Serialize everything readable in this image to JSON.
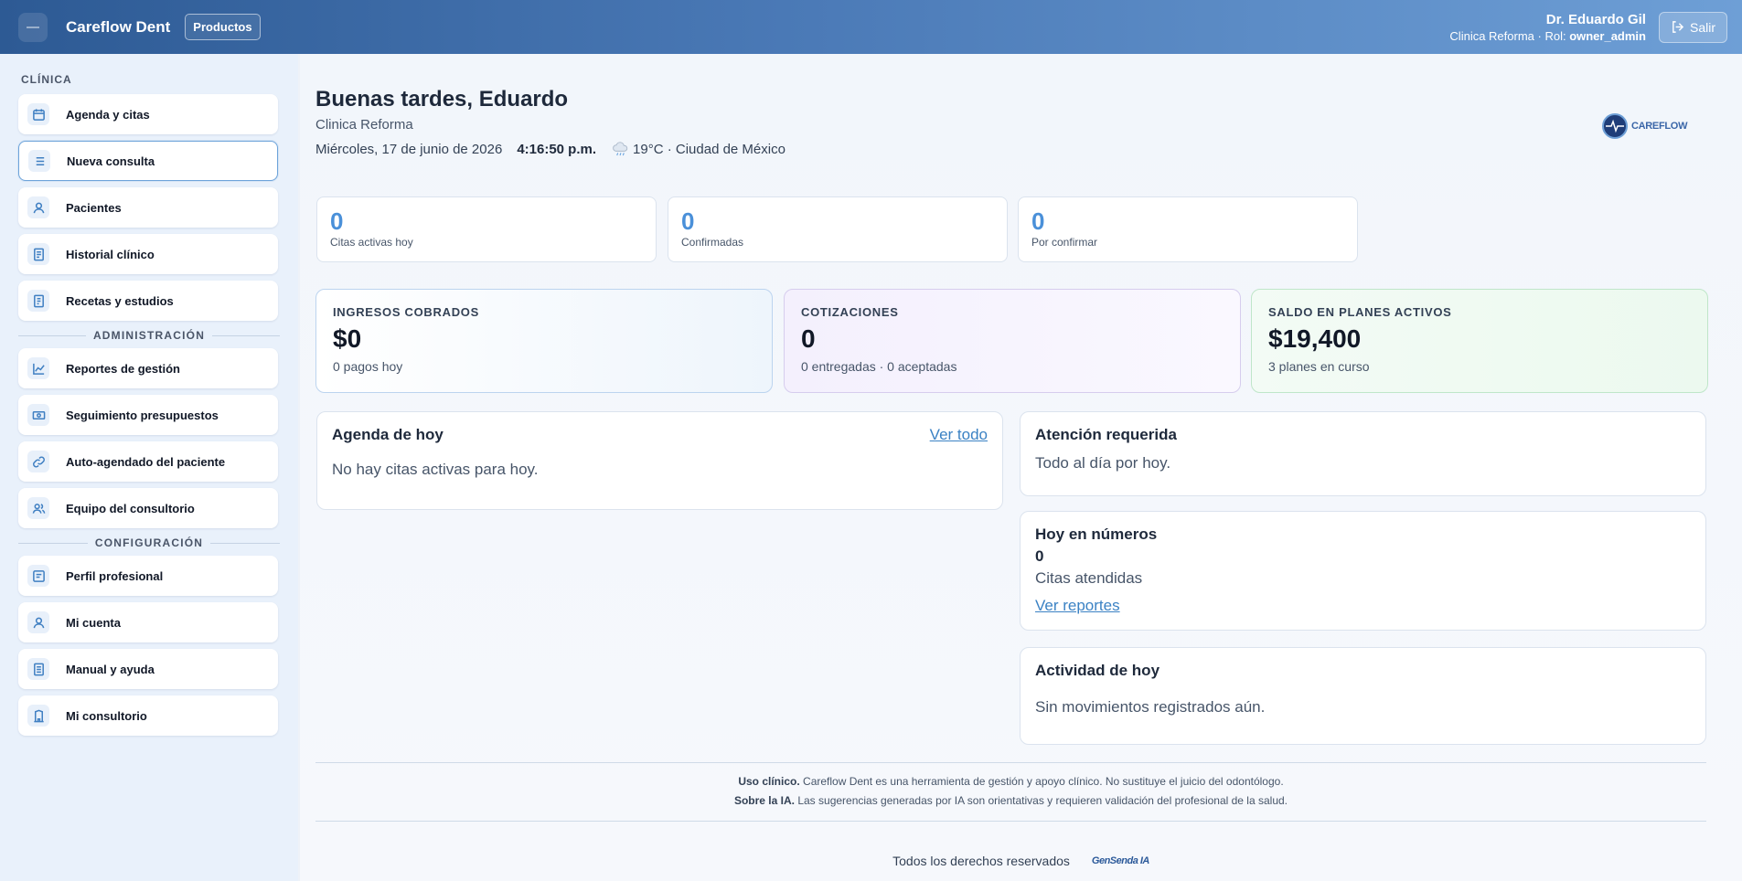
{
  "header": {
    "app_title": "Careflow Dent",
    "products_label": "Productos",
    "user_name": "Dr. Eduardo Gil",
    "clinic_prefix": "Clinica Reforma · Rol: ",
    "role": "owner_admin",
    "logout_label": "Salir"
  },
  "sidebar": {
    "section_clinica": "CLÍNICA",
    "clinica_items": [
      {
        "label": "Agenda y citas",
        "icon": "calendar-icon"
      },
      {
        "label": "Nueva consulta",
        "icon": "list-icon"
      },
      {
        "label": "Pacientes",
        "icon": "user-icon"
      },
      {
        "label": "Historial clínico",
        "icon": "document-icon"
      },
      {
        "label": "Recetas y estudios",
        "icon": "prescription-icon"
      }
    ],
    "section_admin": "ADMINISTRACIÓN",
    "admin_items": [
      {
        "label": "Reportes de gestión",
        "icon": "chart-icon"
      },
      {
        "label": "Seguimiento presupuestos",
        "icon": "money-icon"
      },
      {
        "label": "Auto-agendado del paciente",
        "icon": "link-icon"
      },
      {
        "label": "Equipo del consultorio",
        "icon": "team-icon"
      }
    ],
    "section_config": "CONFIGURACIÓN",
    "config_items": [
      {
        "label": "Perfil profesional",
        "icon": "profile-card-icon"
      },
      {
        "label": "Mi cuenta",
        "icon": "account-icon"
      },
      {
        "label": "Manual y ayuda",
        "icon": "manual-icon"
      },
      {
        "label": "Mi consultorio",
        "icon": "building-icon"
      }
    ]
  },
  "main": {
    "greeting": "Buenas tardes, Eduardo",
    "clinic_name": "Clinica Reforma",
    "date": "Miércoles, 17 de junio de 2026",
    "time": "4:16:50 p.m.",
    "weather": "19°C · Ciudad de México",
    "brand_logo_text": "CAREFLOW"
  },
  "mini_stats": [
    {
      "value": "0",
      "label": "Citas activas hoy"
    },
    {
      "value": "0",
      "label": "Confirmadas"
    },
    {
      "value": "0",
      "label": "Por confirmar"
    }
  ],
  "kpis": {
    "ingresos": {
      "label": "INGRESOS COBRADOS",
      "value": "$0",
      "sub": "0 pagos hoy"
    },
    "cotizaciones": {
      "label": "COTIZACIONES",
      "value": "0",
      "sub": "0 entregadas · 0 aceptadas"
    },
    "saldo": {
      "label": "SALDO EN PLANES ACTIVOS",
      "value": "$19,400",
      "sub": "3 planes en curso"
    }
  },
  "agenda": {
    "title": "Agenda de hoy",
    "link": "Ver todo",
    "empty": "No hay citas activas para hoy."
  },
  "atencion": {
    "title": "Atención requerida",
    "text": "Todo al día por hoy."
  },
  "numeros": {
    "title": "Hoy en números",
    "value": "0",
    "label": "Citas atendidas",
    "link": "Ver reportes"
  },
  "actividad": {
    "title": "Actividad de hoy",
    "text": "Sin movimientos registrados aún."
  },
  "footer": {
    "uso_bold": "Uso clínico.",
    "uso_text": " Careflow Dent es una herramienta de gestión y apoyo clínico. No sustituye el juicio del odontólogo.",
    "ia_bold": "Sobre la IA.",
    "ia_text": " Las sugerencias generadas por IA son orientativas y requieren validación del profesional de la salud.",
    "rights": "Todos los derechos reservados",
    "ia_logo_text": "GenSenda IA"
  }
}
